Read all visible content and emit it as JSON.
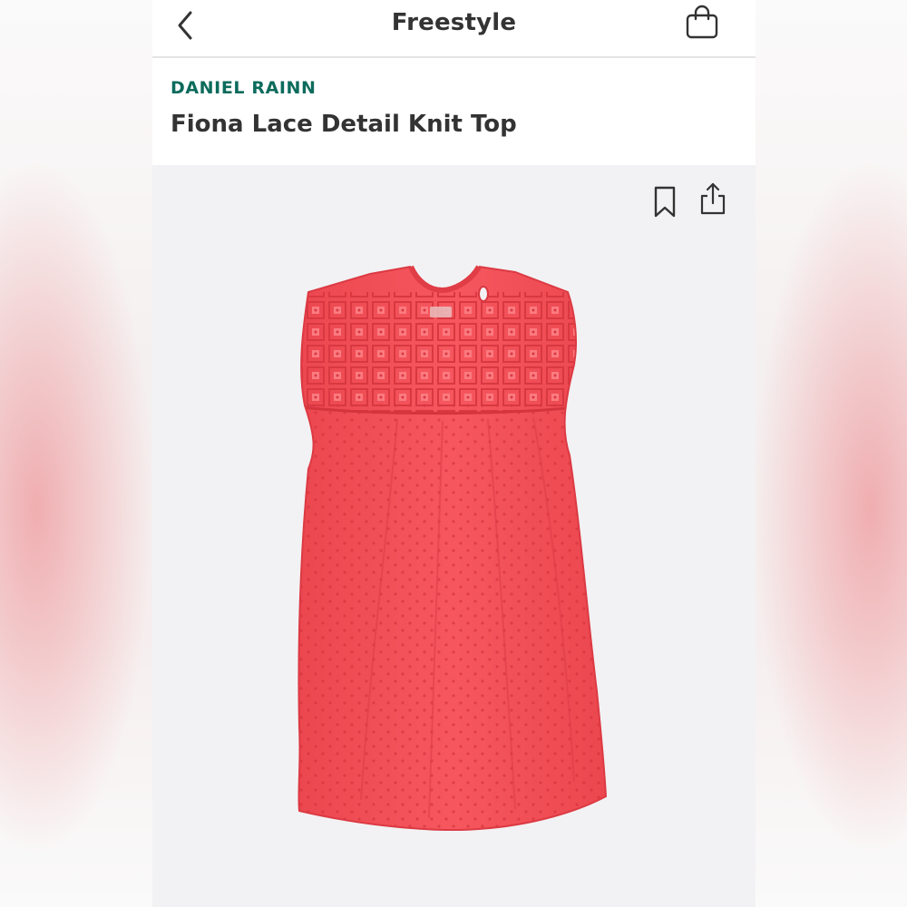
{
  "nav": {
    "title": "Freestyle",
    "back_icon": "chevron-left-icon",
    "bag_icon": "shopping-bag-icon"
  },
  "product": {
    "brand": "DANIEL RAINN",
    "name": "Fiona Lace Detail Knit Top",
    "image": "coral-red-sleeveless-lace-yoke-knit-top",
    "color": "#f2545b"
  },
  "actions": {
    "save_icon": "bookmark-icon",
    "share_icon": "share-icon"
  },
  "colors": {
    "brand": "#0c6b5c",
    "title": "#333333",
    "image_background": "#f2f2f4"
  }
}
